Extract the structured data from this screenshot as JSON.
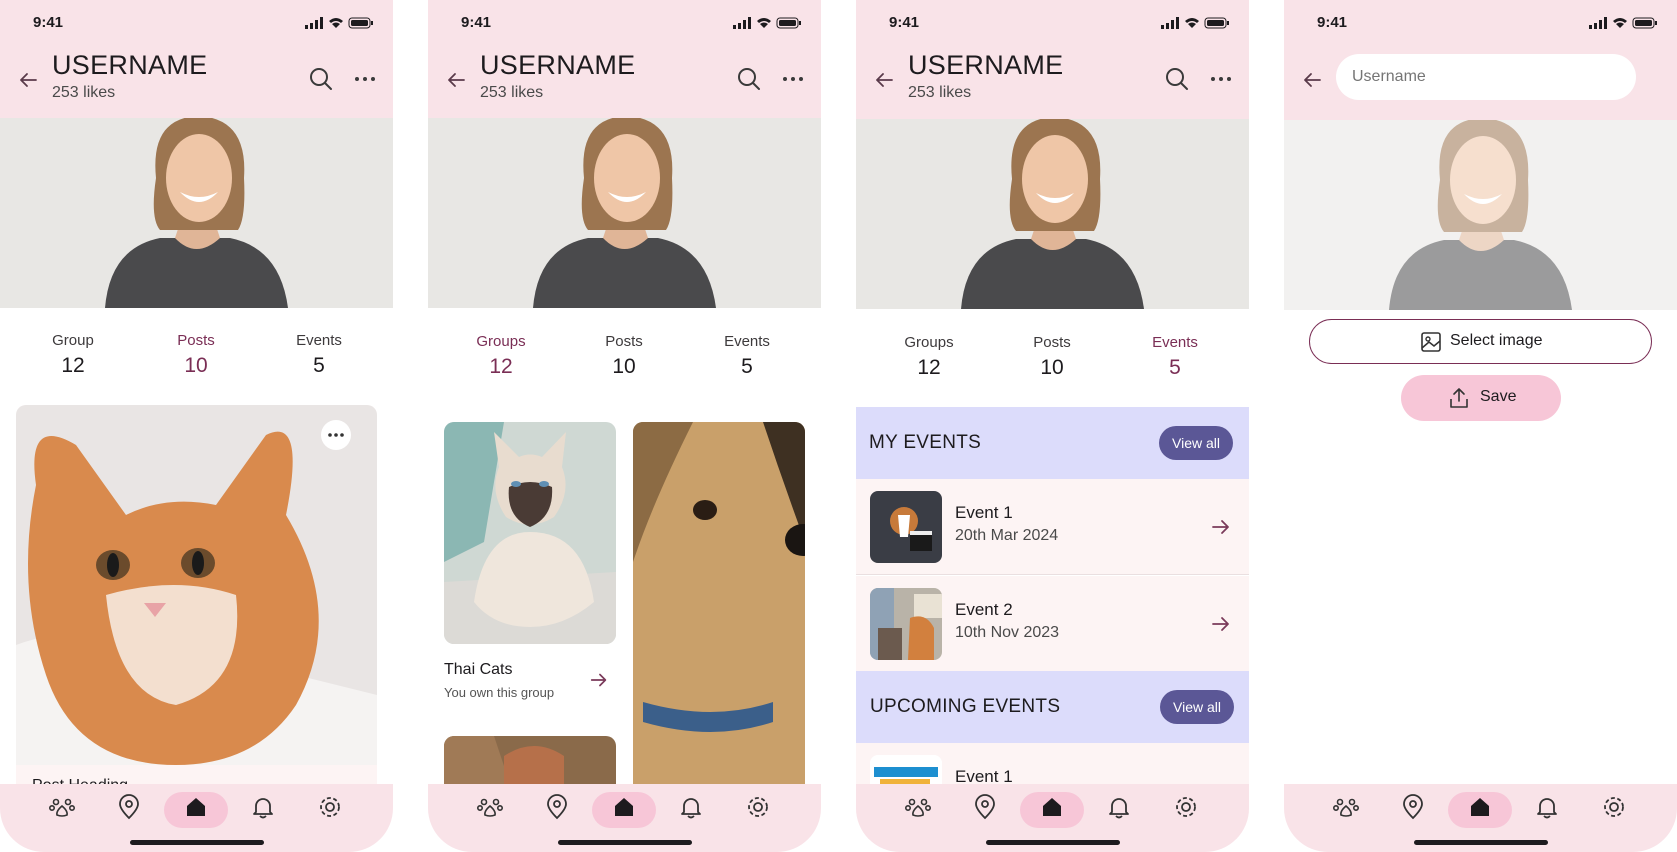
{
  "status": {
    "time": "9:41"
  },
  "profile": {
    "username": "USERNAME",
    "likes": "253 likes"
  },
  "screen1": {
    "stats": [
      {
        "label": "Group",
        "value": "12"
      },
      {
        "label": "Posts",
        "value": "10"
      },
      {
        "label": "Events",
        "value": "5"
      }
    ],
    "active_stat": "Posts",
    "post_title": "Post Heading"
  },
  "screen2": {
    "stats": [
      {
        "label": "Groups",
        "value": "12"
      },
      {
        "label": "Posts",
        "value": "10"
      },
      {
        "label": "Events",
        "value": "5"
      }
    ],
    "active_stat": "Groups",
    "group": {
      "name": "Thai Cats",
      "subtitle": "You own this group"
    }
  },
  "screen3": {
    "stats": [
      {
        "label": "Groups",
        "value": "12"
      },
      {
        "label": "Posts",
        "value": "10"
      },
      {
        "label": "Events",
        "value": "5"
      }
    ],
    "active_stat": "Events",
    "my_events_title": "MY EVENTS",
    "upcoming_title": "UPCOMING EVENTS",
    "view_all": "View all",
    "my_events": [
      {
        "name": "Event 1",
        "date": "20th Mar 2024"
      },
      {
        "name": "Event 2",
        "date": "10th Nov 2023"
      }
    ],
    "upcoming_events": [
      {
        "name": "Event 1"
      }
    ]
  },
  "screen4": {
    "username_placeholder": "Username",
    "select_image_label": "Select image",
    "save_label": "Save"
  },
  "nav": {
    "items": [
      "paw-icon",
      "location-icon",
      "home-icon",
      "bell-icon",
      "settings-icon"
    ],
    "active": "home-icon"
  },
  "colors": {
    "header_bg": "#f9e3e8",
    "accent": "#7a2e55",
    "section_bg": "#dcdcfb",
    "button_purple": "#5b5796",
    "pill_pink": "#f7c6d7"
  }
}
